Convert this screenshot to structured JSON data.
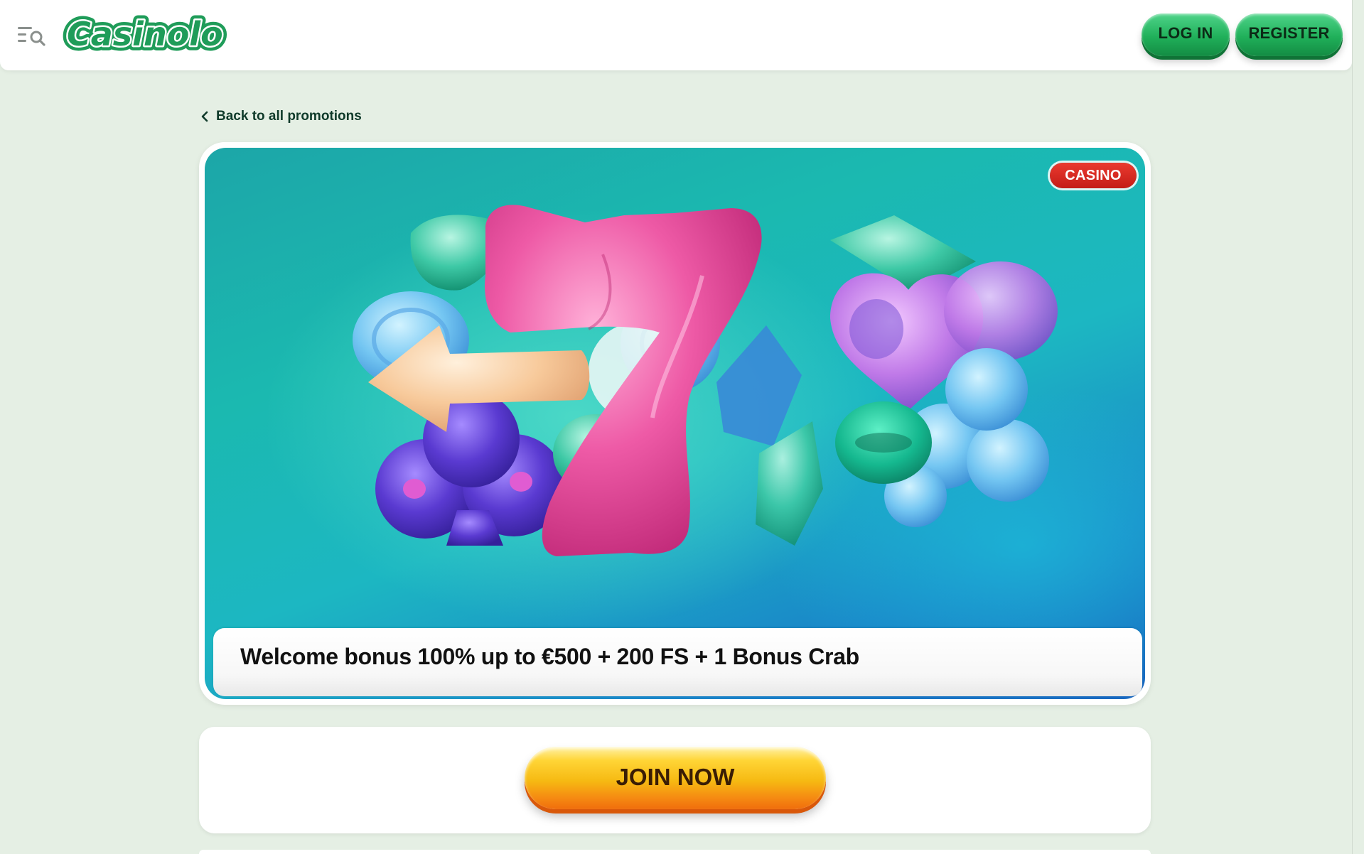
{
  "header": {
    "brand": "Casinolo",
    "login_label": "LOG IN",
    "register_label": "REGISTER",
    "menu_icon": "menu-search-icon"
  },
  "nav": {
    "back_label": "Back to all promotions"
  },
  "promo": {
    "badge": "CASINO",
    "title": "Welcome bonus 100% up to €500 + 200 FS + 1 Bonus Crab"
  },
  "cta": {
    "join_label": "JOIN NOW"
  },
  "colors": {
    "brand_green": "#1f9c59",
    "button_green": "#20b05a",
    "badge_red": "#d0231b",
    "cta_yellow": "#f6b912",
    "background": "#e5efe4"
  }
}
